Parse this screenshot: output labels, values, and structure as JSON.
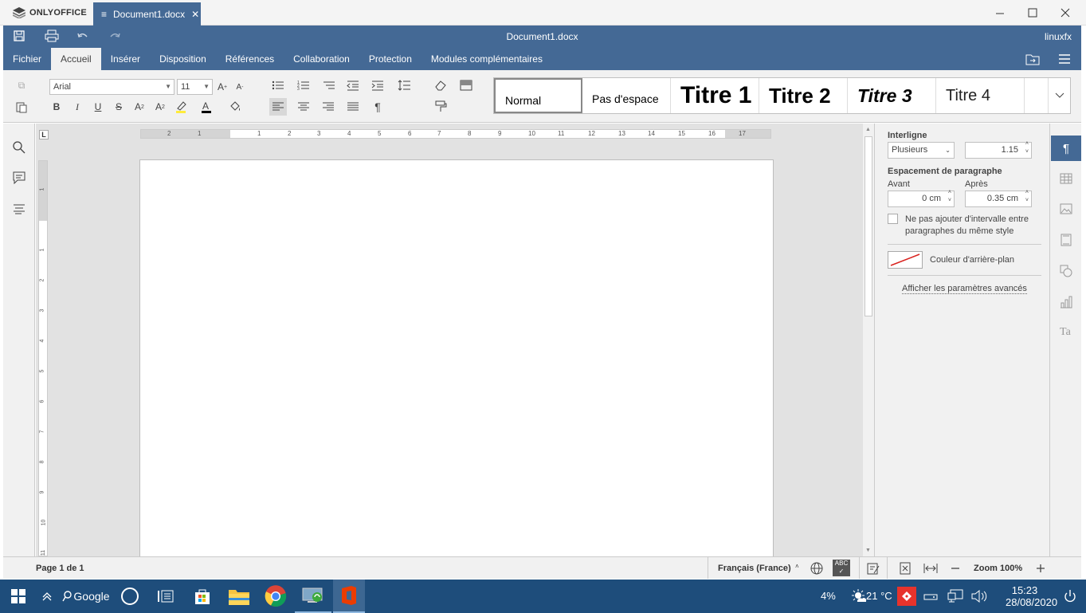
{
  "app": {
    "brand": "ONLYOFFICE",
    "tab_title": "Document1.docx",
    "doc_title": "Document1.docx",
    "user": "linuxfx"
  },
  "colors": {
    "header": "#446995",
    "taskbar": "#1e4d7b",
    "toolbar": "#f1f1f1",
    "canvas": "#e2e2e2"
  },
  "menu": {
    "tabs": [
      "Fichier",
      "Accueil",
      "Insérer",
      "Disposition",
      "Références",
      "Collaboration",
      "Protection",
      "Modules complémentaires"
    ],
    "active": "Accueil"
  },
  "toolbar": {
    "font_name": "Arial",
    "font_size": "11"
  },
  "styles": [
    "Normal",
    "Pas d'espace",
    "Titre 1",
    "Titre 2",
    "Titre 3",
    "Titre 4"
  ],
  "hruler": {
    "ticks": [
      "2",
      "1",
      "1",
      "1",
      "2",
      "3",
      "4",
      "5",
      "6",
      "7",
      "8",
      "9",
      "10",
      "11",
      "12",
      "13",
      "14",
      "15",
      "16",
      "17"
    ]
  },
  "vruler": {
    "ticks": [
      "1",
      "1",
      "2",
      "3",
      "4",
      "5",
      "6",
      "7",
      "8",
      "9",
      "10",
      "11"
    ]
  },
  "panel": {
    "line_spacing_label": "Interligne",
    "line_spacing_mode": "Plusieurs",
    "line_spacing_value": "1.15",
    "para_spacing_label": "Espacement de paragraphe",
    "before_label": "Avant",
    "before_value": "0 cm",
    "after_label": "Après",
    "after_value": "0.35 cm",
    "no_interval_label": "Ne pas ajouter d'intervalle entre paragraphes du même style",
    "bg_color_label": "Couleur d'arrière-plan",
    "advanced_link": "Afficher les paramètres avancés"
  },
  "status": {
    "page": "Page 1 de 1",
    "language": "Français (France)",
    "zoom": "Zoom 100%"
  },
  "taskbar": {
    "search": "Google",
    "battery": "4%",
    "weather": "21 °C",
    "time": "15:23",
    "date": "28/08/2020"
  }
}
